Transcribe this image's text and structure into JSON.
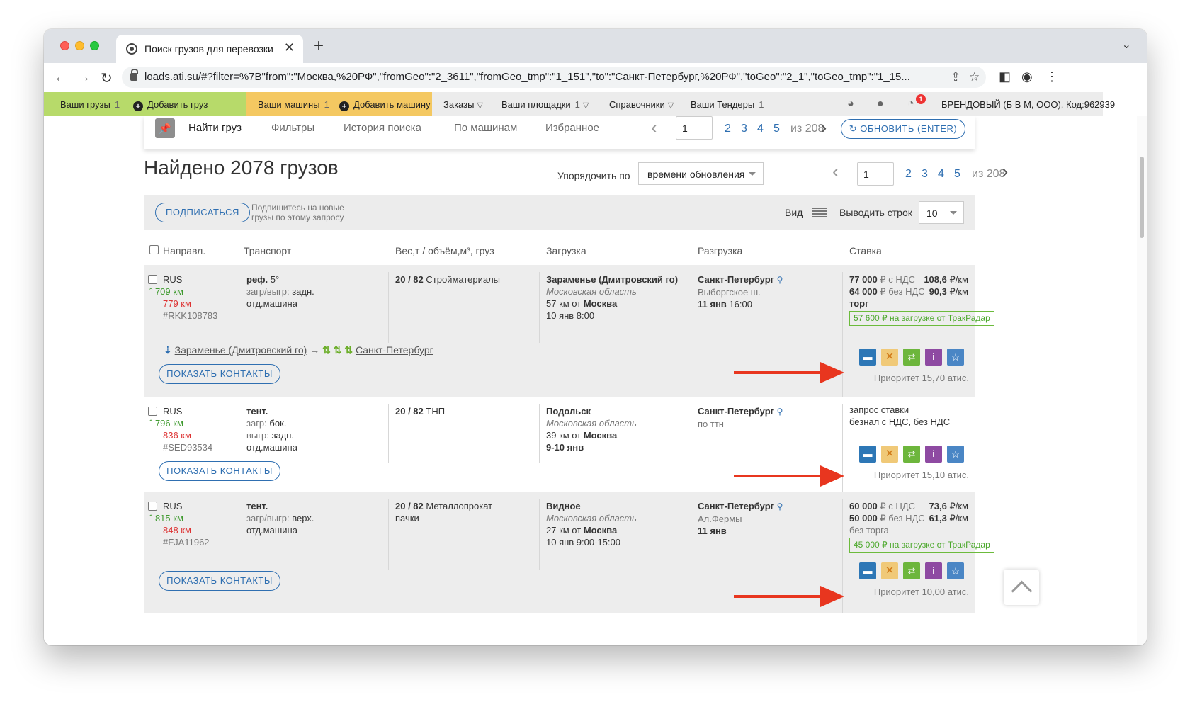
{
  "browser": {
    "tab_title": "Поиск грузов для перевозки",
    "tab_close": "✕",
    "new_tab": "+",
    "url": "loads.ati.su/#?filter=%7B\"from\":\"Москва,%20РФ\",\"fromGeo\":\"2_3611\",\"fromGeo_tmp\":\"1_151\",\"to\":\"Санкт-Петербург,%20РФ\",\"toGeo\":\"2_1\",\"toGeo_tmp\":\"1_15..."
  },
  "sitebar": {
    "your_loads": "Ваши грузы",
    "your_loads_count": "1",
    "add_load": "Добавить груз",
    "your_trucks": "Ваши машины",
    "your_trucks_count": "1",
    "add_truck": "Добавить машину",
    "orders": "Заказы",
    "platforms": "Ваши площадки",
    "platforms_count": "1",
    "directories": "Справочники",
    "tenders": "Ваши Тендеры",
    "tenders_count": "1",
    "notifications_badge": "1",
    "company": "БРЕНДОВЫЙ (Б В М, ООО),  Код:962939"
  },
  "search_panel": {
    "tabs": [
      "Найти груз",
      "Фильтры",
      "История поиска",
      "По машинам",
      "Избранное"
    ],
    "page_value": "1",
    "pages": [
      "2",
      "3",
      "4",
      "5"
    ],
    "total": "из 208",
    "refresh_label": "ОБНОВИТЬ (ENTER)"
  },
  "results": {
    "title": "Найдено 2078 грузов",
    "sort_label": "Упорядочить по",
    "sort_value": "времени обновления",
    "page_value": "1",
    "pages": [
      "2",
      "3",
      "4",
      "5"
    ],
    "total": "из 208"
  },
  "subscribe": {
    "button": "ПОДПИСАТЬСЯ",
    "text": "Подпишитесь на новые грузы по этому запросу",
    "view_label": "Вид",
    "rows_label": "Выводить строк",
    "rows_value": "10"
  },
  "table": {
    "headers": [
      "Направл.",
      "Транспорт",
      "Вес,т / объём,м³, груз",
      "Загрузка",
      "Разгрузка",
      "Ставка"
    ]
  },
  "rows": [
    {
      "country": "RUS",
      "dist1": "709 км",
      "dist2": "779 км",
      "code": "#RKK108783",
      "transport_type": "реф.",
      "transport_extra": " 5°",
      "t_line2_label": "загр/выгр:",
      "t_line2_value": " задн.",
      "t_line3": "отд.машина",
      "t_line4_label": "",
      "t_line4_value": "",
      "weight": "20 / 82",
      "cargo": " Стройматериалы",
      "cargo2": "",
      "load_city": "Зараменье (Дмитровский го)",
      "load_region": "Московская область",
      "load_dist": "57 км от",
      "load_dist_city": " Москва",
      "load_date": "10 янв 8:00",
      "unload_city": "Санкт-Петербург",
      "unload_addr": "Выборгское ш.",
      "unload_date": "11 янв",
      "unload_time": " 16:00",
      "rate_vat": "77 000",
      "rate_vat_suffix": " ₽ с НДС",
      "rate_novat": "64 000",
      "rate_novat_suffix": " ₽ без НДС",
      "rate_km1": "108,6",
      "rate_km2": "90,3",
      "rate_km_unit": " ₽/км",
      "rate_note": "торг",
      "radar": "57 600 ₽ на загрузке от ТракРадар",
      "route_from": "Зараменье (Дмитровский го)",
      "route_to": "Санкт-Петербург",
      "contacts": "ПОКАЗАТЬ КОНТАКТЫ",
      "priority": "Приоритет 15,70 атис."
    },
    {
      "country": "RUS",
      "dist1": "796 км",
      "dist2": "836 км",
      "code": "#SED93534",
      "transport_type": "тент.",
      "transport_extra": "",
      "t_line2_label": "загр:",
      "t_line2_value": " бок.",
      "t_line3": "отд.машина",
      "t_line4_label": "выгр:",
      "t_line4_value": " задн.",
      "weight": "20 / 82",
      "cargo": " ТНП",
      "load_city": "Подольск",
      "load_region": "Московская область",
      "load_dist": "39 км от",
      "load_dist_city": " Москва",
      "load_date": "9-10 янв",
      "unload_city": "Санкт-Петербург",
      "unload_addr": "по ттн",
      "rate_request": "запрос ставки",
      "rate_terms": "безнал с НДС, без НДС",
      "contacts": "ПОКАЗАТЬ КОНТАКТЫ",
      "priority": "Приоритет 15,10 атис."
    },
    {
      "country": "RUS",
      "dist1": "815 км",
      "dist2": "848 км",
      "code": "#FJA11962",
      "transport_type": "тент.",
      "t_line2_label": "загр/выгр:",
      "t_line2_value": " верх.",
      "t_line3": "отд.машина",
      "weight": "20 / 82",
      "cargo": " Металлопрокат",
      "cargo2": "пачки",
      "load_city": "Видное",
      "load_region": "Московская область",
      "load_dist": "27 км от",
      "load_dist_city": " Москва",
      "load_date": "10 янв 9:00-15:00",
      "unload_city": "Санкт-Петербург",
      "unload_addr": "Ал.Фермы",
      "unload_date": "11 янв",
      "rate_vat": "60 000",
      "rate_vat_suffix": " ₽ с НДС",
      "rate_novat": "50 000",
      "rate_novat_suffix": " ₽ без НДС",
      "rate_km1": "73,6",
      "rate_km2": "61,3",
      "rate_km_unit": " ₽/км",
      "rate_note": "без торга",
      "radar": "45 000 ₽ на загрузке от ТракРадар",
      "contacts": "ПОКАЗАТЬ КОНТАКТЫ",
      "priority": "Приоритет 10,00 атис."
    }
  ],
  "icons": {
    "chat": "chat-icon",
    "cancel": "cross-icon",
    "swap": "swap-icon",
    "info": "info-icon",
    "star": "star-icon"
  },
  "colors": {
    "accent_blue": "#2f6fb1",
    "loads_bar": "#b7da6a",
    "trucks_bar": "#f4c861",
    "annotation_arrow": "#e8361f"
  }
}
